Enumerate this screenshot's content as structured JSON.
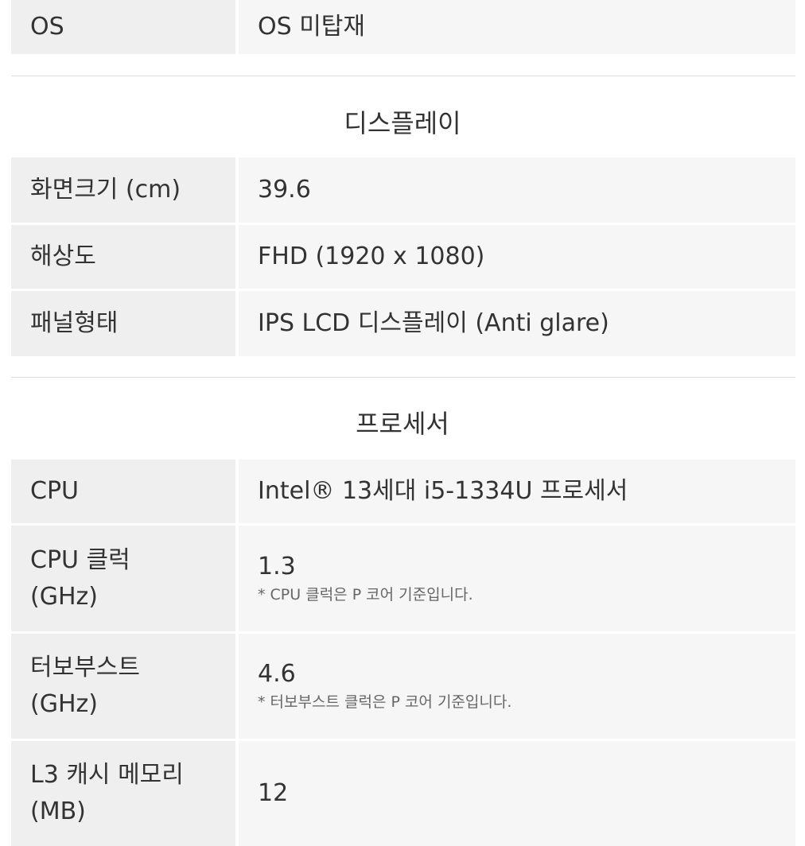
{
  "top": {
    "label": "OS",
    "value": "OS 미탑재"
  },
  "sections": [
    {
      "title": "디스플레이",
      "rows": [
        {
          "label": "화면크기 (cm)",
          "value": "39.6"
        },
        {
          "label": "해상도",
          "value": "FHD (1920 x 1080)"
        },
        {
          "label": "패널형태",
          "value": "IPS LCD 디스플레이 (Anti glare)"
        }
      ]
    },
    {
      "title": "프로세서",
      "rows": [
        {
          "label": "CPU",
          "value": "Intel® 13세대 i5-1334U 프로세서"
        },
        {
          "label": "CPU 클럭",
          "label2": "(GHz)",
          "value": "1.3",
          "note": "* CPU 클럭은 P 코어 기준입니다."
        },
        {
          "label": "터보부스트",
          "label2": "(GHz)",
          "value": "4.6",
          "note": "* 터보부스트 클럭은 P 코어 기준입니다."
        },
        {
          "label": "L3 캐시 메모리",
          "label2": "(MB)",
          "value": "12"
        }
      ]
    }
  ]
}
